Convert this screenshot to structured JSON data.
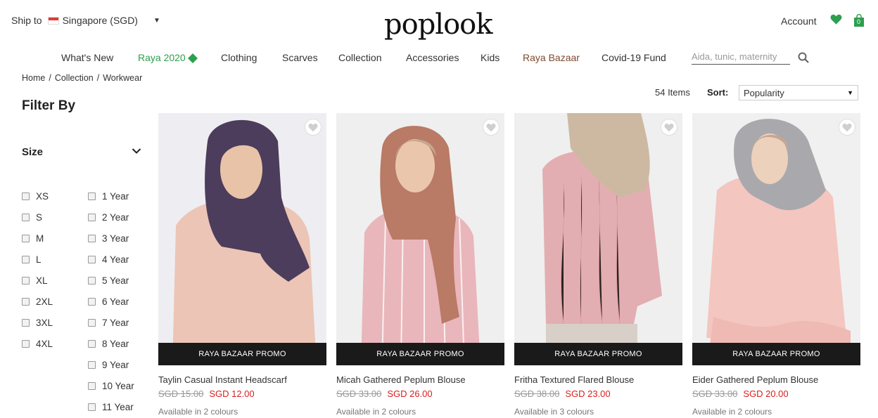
{
  "header": {
    "ship_label": "Ship to",
    "country": "Singapore (SGD)",
    "logo": "poplook",
    "account": "Account",
    "cart_count": "0",
    "icons": [
      "singapore-flag-icon",
      "chevron-down-icon",
      "heart-icon",
      "shopping-bag-icon",
      "search-icon"
    ]
  },
  "nav": {
    "items": [
      "What's New",
      "Raya 2020",
      "Clothing",
      "Scarves",
      "Collection",
      "Accessories",
      "Kids",
      "Raya Bazaar",
      "Covid-19 Fund"
    ],
    "search_placeholder": "Aida, tunic, maternity"
  },
  "breadcrumb": [
    "Home",
    "Collection",
    "Workwear"
  ],
  "filter": {
    "title": "Filter By",
    "size_heading": "Size",
    "sizes_left": [
      "XS",
      "S",
      "M",
      "L",
      "XL",
      "2XL",
      "3XL",
      "4XL"
    ],
    "sizes_right": [
      "1 Year",
      "2 Year",
      "3 Year",
      "4 Year",
      "5 Year",
      "6 Year",
      "7 Year",
      "8 Year",
      "9 Year",
      "10 Year",
      "11 Year"
    ]
  },
  "sort": {
    "count": "54 Items",
    "label": "Sort:",
    "selected": "Popularity"
  },
  "products": [
    {
      "name": "Taylin Casual Instant Headscarf",
      "old_price": "SGD 15.00",
      "price": "SGD 12.00",
      "availability": "Available in 2 colours",
      "badge": "RAYA BAZAAR PROMO"
    },
    {
      "name": "Micah Gathered Peplum Blouse",
      "old_price": "SGD 33.00",
      "price": "SGD 26.00",
      "availability": "Available in 2 colours",
      "badge": "RAYA BAZAAR PROMO"
    },
    {
      "name": "Fritha Textured Flared Blouse",
      "old_price": "SGD 38.00",
      "price": "SGD 23.00",
      "availability": "Available in 3 colours",
      "badge": "RAYA BAZAAR PROMO"
    },
    {
      "name": "Eider Gathered Peplum Blouse",
      "old_price": "SGD 33.00",
      "price": "SGD 20.00",
      "availability": "Available in 2 colours",
      "badge": "RAYA BAZAAR PROMO"
    }
  ],
  "colors": {
    "accent_green": "#2e9e4f",
    "sale_red": "#d81e1e",
    "bazaar_brown": "#7b4a2e",
    "promo_bar": "#1a1a1a"
  }
}
